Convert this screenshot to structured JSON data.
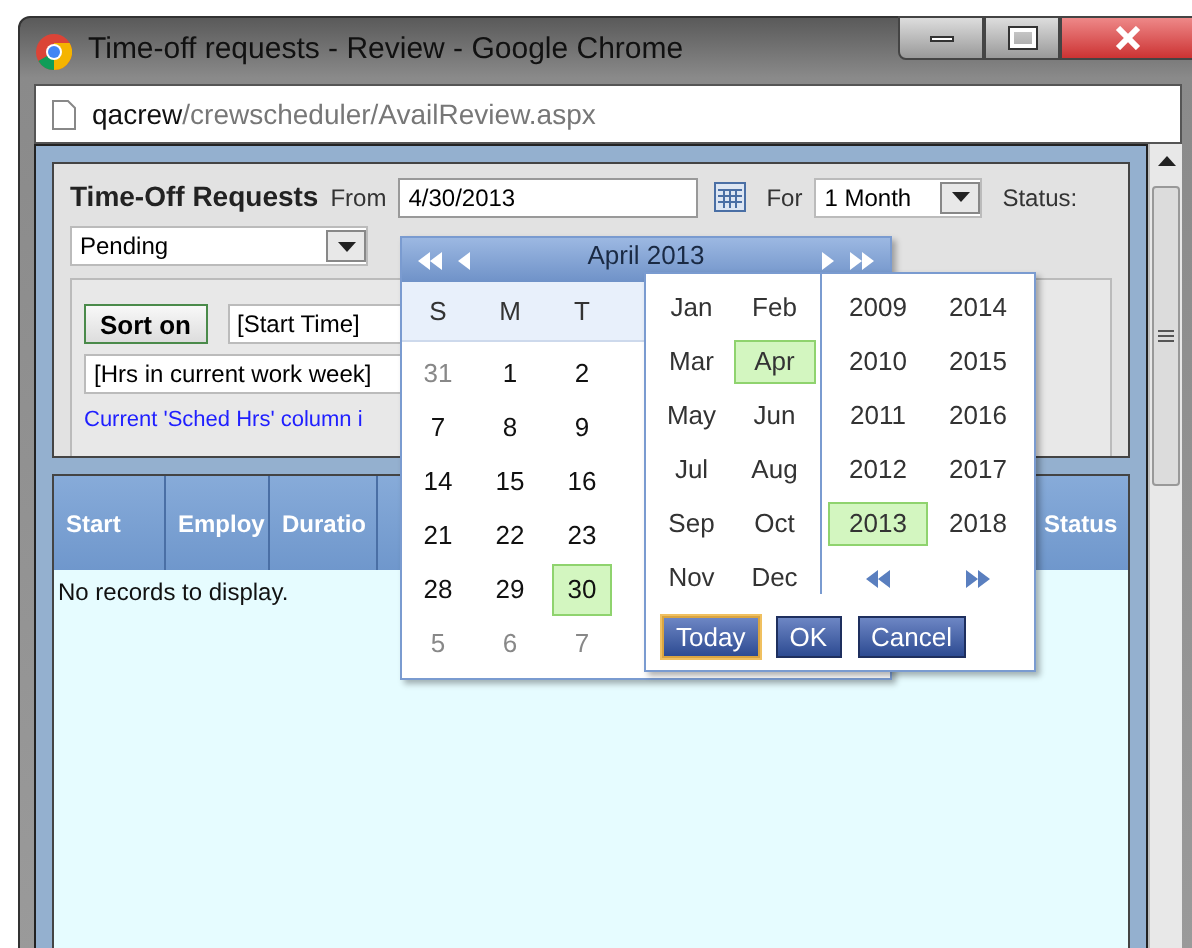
{
  "window": {
    "title": "Time-off requests - Review - Google Chrome"
  },
  "address": {
    "host": "qacrew",
    "path": "/crewscheduler/AvailReview.aspx"
  },
  "filter": {
    "title": "Time-Off Requests",
    "from_label": "From",
    "from_value": "4/30/2013",
    "for_label": "For",
    "for_value": "1 Month",
    "status_label": "Status:",
    "status_value": "Pending"
  },
  "sort": {
    "button": "Sort on",
    "field_1": "[Start Time]",
    "field_2": "[Hrs in current work week]",
    "note": "Current 'Sched Hrs' column i"
  },
  "grid": {
    "columns": [
      "Start",
      "Employ",
      "Duratio",
      "Status"
    ],
    "empty_text": "No records to display."
  },
  "calendar": {
    "title": "April 2013",
    "weekdays": [
      "S",
      "M",
      "T"
    ],
    "weeks": [
      [
        {
          "day": "31",
          "other_month": true,
          "selected": false
        },
        {
          "day": "1",
          "other_month": false,
          "selected": false
        },
        {
          "day": "2",
          "other_month": false,
          "selected": false
        }
      ],
      [
        {
          "day": "7",
          "other_month": false,
          "selected": false
        },
        {
          "day": "8",
          "other_month": false,
          "selected": false
        },
        {
          "day": "9",
          "other_month": false,
          "selected": false
        }
      ],
      [
        {
          "day": "14",
          "other_month": false,
          "selected": false
        },
        {
          "day": "15",
          "other_month": false,
          "selected": false
        },
        {
          "day": "16",
          "other_month": false,
          "selected": false
        }
      ],
      [
        {
          "day": "21",
          "other_month": false,
          "selected": false
        },
        {
          "day": "22",
          "other_month": false,
          "selected": false
        },
        {
          "day": "23",
          "other_month": false,
          "selected": false
        }
      ],
      [
        {
          "day": "28",
          "other_month": false,
          "selected": false
        },
        {
          "day": "29",
          "other_month": false,
          "selected": false
        },
        {
          "day": "30",
          "other_month": false,
          "selected": true
        }
      ],
      [
        {
          "day": "5",
          "other_month": true,
          "selected": false
        },
        {
          "day": "6",
          "other_month": true,
          "selected": false
        },
        {
          "day": "7",
          "other_month": true,
          "selected": false
        }
      ]
    ]
  },
  "picker": {
    "months": [
      {
        "label": "Jan",
        "selected": false
      },
      {
        "label": "Feb",
        "selected": false
      },
      {
        "label": "Mar",
        "selected": false
      },
      {
        "label": "Apr",
        "selected": true
      },
      {
        "label": "May",
        "selected": false
      },
      {
        "label": "Jun",
        "selected": false
      },
      {
        "label": "Jul",
        "selected": false
      },
      {
        "label": "Aug",
        "selected": false
      },
      {
        "label": "Sep",
        "selected": false
      },
      {
        "label": "Oct",
        "selected": false
      },
      {
        "label": "Nov",
        "selected": false
      },
      {
        "label": "Dec",
        "selected": false
      }
    ],
    "years": [
      {
        "label": "2009",
        "selected": false
      },
      {
        "label": "2014",
        "selected": false
      },
      {
        "label": "2010",
        "selected": false
      },
      {
        "label": "2015",
        "selected": false
      },
      {
        "label": "2011",
        "selected": false
      },
      {
        "label": "2016",
        "selected": false
      },
      {
        "label": "2012",
        "selected": false
      },
      {
        "label": "2017",
        "selected": false
      },
      {
        "label": "2013",
        "selected": true
      },
      {
        "label": "2018",
        "selected": false
      }
    ],
    "buttons": [
      {
        "label": "Today",
        "focused": true
      },
      {
        "label": "OK",
        "focused": false
      },
      {
        "label": "Cancel",
        "focused": false
      }
    ]
  }
}
